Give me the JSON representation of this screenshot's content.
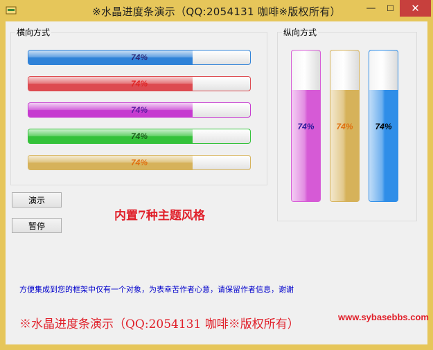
{
  "window": {
    "title": "※水晶进度条演示（QQ:2054131 咖啡※版权所有）",
    "minimize_glyph": "—",
    "maximize_glyph": "☐",
    "close_glyph": "✕",
    "frame_color": "#e6c65a"
  },
  "horizontal_group": {
    "title": "横向方式",
    "bars": [
      {
        "theme": "blue",
        "value": 74,
        "label": "74%",
        "fill_color": "#2f82d8",
        "label_color": "#2a2a7a"
      },
      {
        "theme": "red",
        "value": 74,
        "label": "74%",
        "fill_color": "#dd4a50",
        "label_color": "#e02525"
      },
      {
        "theme": "purple",
        "value": 74,
        "label": "74%",
        "fill_color": "#c63ad0",
        "label_color": "#5a1aa0"
      },
      {
        "theme": "green",
        "value": 74,
        "label": "74%",
        "fill_color": "#34c23a",
        "label_color": "#1a5e1a"
      },
      {
        "theme": "gold",
        "value": 74,
        "label": "74%",
        "fill_color": "#d6b25a",
        "label_color": "#e07010"
      }
    ]
  },
  "vertical_group": {
    "title": "纵向方式",
    "bars": [
      {
        "theme": "pink",
        "value": 74,
        "label": "74%",
        "fill_color": "#d65ad6",
        "label_color": "#2a1a9a"
      },
      {
        "theme": "gold",
        "value": 74,
        "label": "74%",
        "fill_color": "#d6b25a",
        "label_color": "#e07010"
      },
      {
        "theme": "blue",
        "value": 74,
        "label": "74%",
        "fill_color": "#2f8ee8",
        "label_color": "#000000"
      }
    ]
  },
  "buttons": {
    "demo": "演示",
    "pause": "暂停"
  },
  "theme_label": "内置7种主题风格",
  "notice": "方便集成到您的框架中仅有一个对象，为表幸苦作者心意，请保留作者信息，谢谢",
  "footer": "※水晶进度条演示（QQ:2054131 咖啡※版权所有）",
  "url": "www.sybasebbs.com"
}
